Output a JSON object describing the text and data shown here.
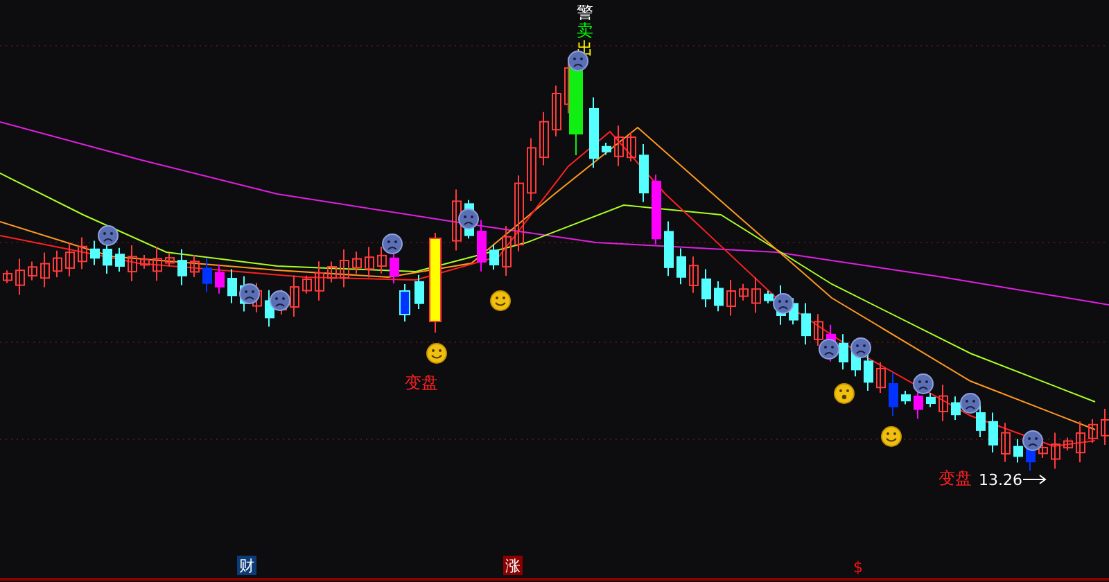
{
  "signal_label": [
    {
      "text": "警",
      "color": "#ffffff"
    },
    {
      "text": "卖",
      "color": "#00ff00"
    },
    {
      "text": "出",
      "color": "#ffff00"
    }
  ],
  "annotations": [
    {
      "kind": "label",
      "text": "变盘"
    },
    {
      "kind": "label",
      "text": "变盘"
    },
    {
      "kind": "price",
      "text": "13.26"
    }
  ],
  "bottom_markers": [
    {
      "kind": "badge",
      "text": "财",
      "color": "#0b3c78"
    },
    {
      "kind": "badge",
      "text": "涨",
      "color": "#8c0000"
    },
    {
      "kind": "plain",
      "text": "$",
      "color": "#ff1010"
    }
  ]
}
